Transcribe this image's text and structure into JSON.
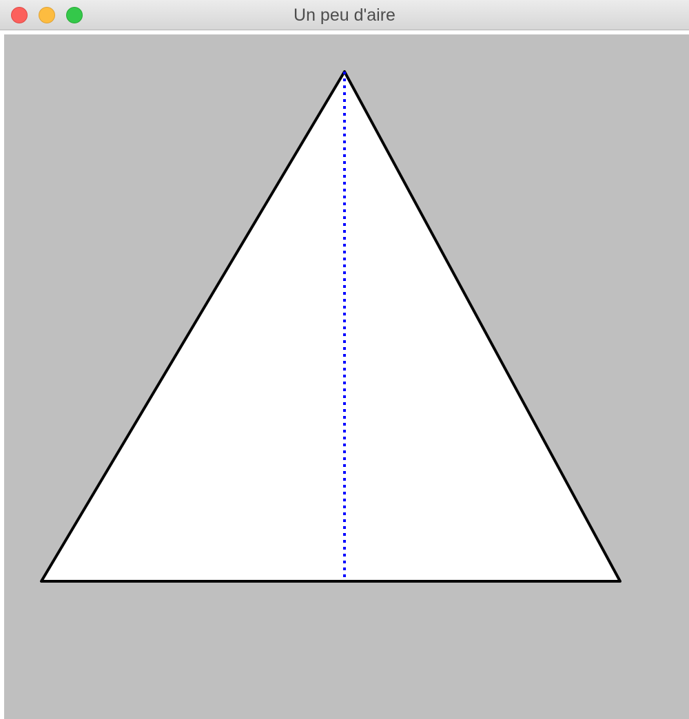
{
  "window": {
    "title": "Un peu d'aire",
    "controls": {
      "close": "close-button",
      "minimize": "minimize-button",
      "zoom": "zoom-button"
    }
  },
  "colors": {
    "canvas_background": "#bfbfbf",
    "triangle_fill": "#ffffff",
    "triangle_stroke": "#000000",
    "height_line": "#0000ff",
    "close": "#fc605c",
    "minimize": "#fdbc40",
    "zoom": "#34c84a"
  },
  "shapes": {
    "triangle": "triangle",
    "height_line": "dotted"
  }
}
